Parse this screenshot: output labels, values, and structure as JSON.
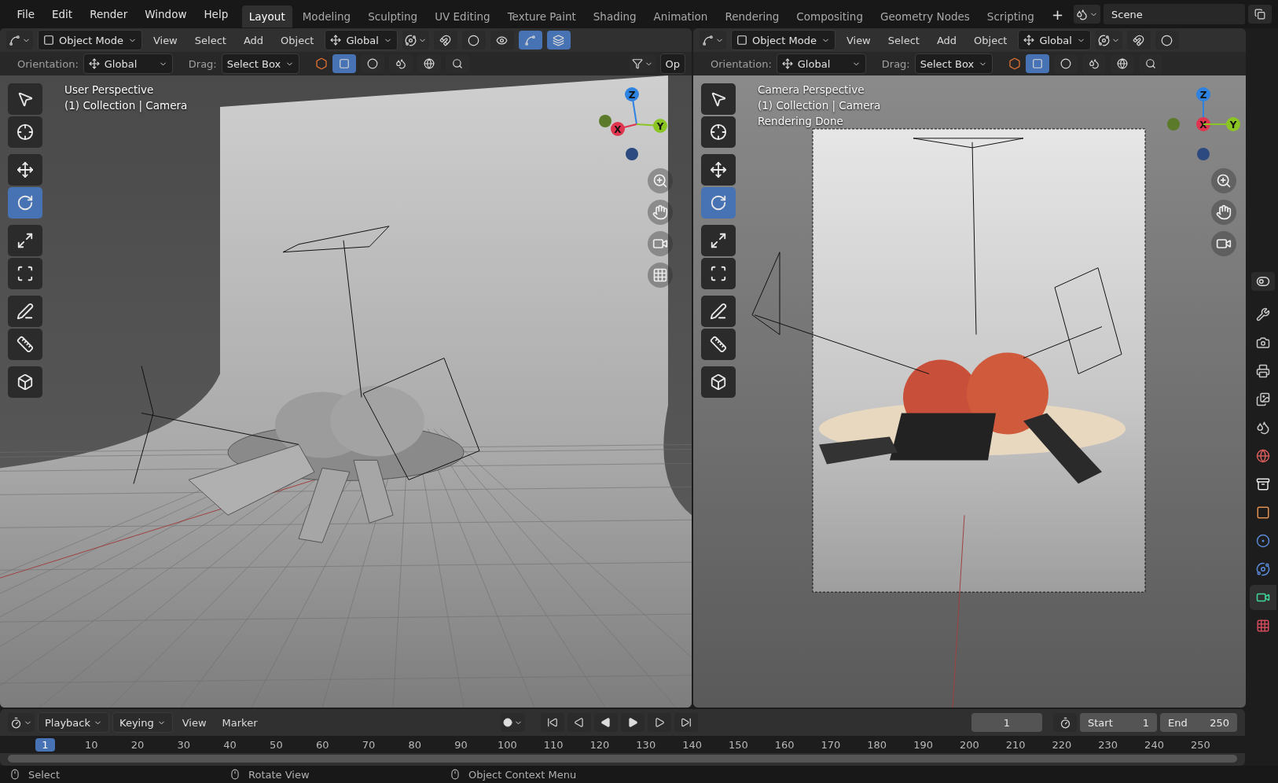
{
  "topbar": {
    "menus": [
      "File",
      "Edit",
      "Render",
      "Window",
      "Help"
    ],
    "workspaces": [
      {
        "label": "Layout",
        "selected": true
      },
      {
        "label": "Modeling",
        "selected": false
      },
      {
        "label": "Sculpting",
        "selected": false
      },
      {
        "label": "UV Editing",
        "selected": false
      },
      {
        "label": "Texture Paint",
        "selected": false
      },
      {
        "label": "Shading",
        "selected": false
      },
      {
        "label": "Animation",
        "selected": false
      },
      {
        "label": "Rendering",
        "selected": false
      },
      {
        "label": "Compositing",
        "selected": false
      },
      {
        "label": "Geometry Nodes",
        "selected": false
      },
      {
        "label": "Scripting",
        "selected": false
      }
    ],
    "add_tab": "+",
    "scene": "Scene"
  },
  "viewports": [
    {
      "kind": "perspective",
      "mode": "Object Mode",
      "menus": [
        "View",
        "Select",
        "Add",
        "Object"
      ],
      "transform": "Global",
      "orientation_label": "Orientation:",
      "orientation": "Global",
      "drag_label": "Drag:",
      "drag": "Select Box",
      "cut_label": "Op",
      "overlay_lines": [
        "User Perspective",
        "(1) Collection | Camera"
      ],
      "toggles": [
        {
          "kind": "snap",
          "on": false
        },
        {
          "kind": "proportional",
          "on": false
        },
        {
          "kind": "visibility",
          "on": false
        },
        {
          "kind": "gizmo",
          "on": true
        },
        {
          "kind": "overlay",
          "on": true
        }
      ],
      "tools": [
        {
          "kind": "select",
          "selected": false
        },
        {
          "kind": "cursor",
          "selected": false
        },
        {
          "kind": "move",
          "selected": false
        },
        {
          "kind": "rotate",
          "selected": true
        },
        {
          "kind": "scale",
          "selected": false
        },
        {
          "kind": "transform",
          "selected": false
        },
        {
          "kind": "annotate",
          "selected": false
        },
        {
          "kind": "measure",
          "selected": false
        },
        {
          "kind": "add-cube",
          "selected": false
        }
      ],
      "axes": [
        {
          "label": "Z",
          "kind": "z"
        },
        {
          "label": "X",
          "kind": "x"
        },
        {
          "label": "Y",
          "kind": "y"
        }
      ],
      "nav": [
        {
          "kind": "zoom"
        },
        {
          "kind": "pan"
        },
        {
          "kind": "camera"
        },
        {
          "kind": "ortho"
        }
      ]
    },
    {
      "kind": "camera",
      "mode": "Object Mode",
      "menus": [
        "View",
        "Select",
        "Add",
        "Object"
      ],
      "transform": "Global",
      "orientation_label": "Orientation:",
      "orientation": "Global",
      "drag_label": "Drag:",
      "drag": "Select Box",
      "overlay_lines": [
        "Camera Perspective",
        "(1) Collection | Camera",
        "Rendering Done"
      ],
      "toggles": [
        {
          "kind": "snap",
          "on": false
        },
        {
          "kind": "proportional",
          "on": false
        }
      ],
      "tools": [
        {
          "kind": "select",
          "selected": false
        },
        {
          "kind": "cursor",
          "selected": false
        },
        {
          "kind": "move",
          "selected": false
        },
        {
          "kind": "rotate",
          "selected": true
        },
        {
          "kind": "scale",
          "selected": false
        },
        {
          "kind": "transform",
          "selected": false
        },
        {
          "kind": "annotate",
          "selected": false
        },
        {
          "kind": "measure",
          "selected": false
        },
        {
          "kind": "add-cube",
          "selected": false
        }
      ],
      "axes": [
        {
          "label": "Z",
          "kind": "z"
        },
        {
          "label": "X",
          "kind": "x"
        },
        {
          "label": "Y",
          "kind": "y"
        }
      ],
      "nav": [
        {
          "kind": "zoom"
        },
        {
          "kind": "pan"
        },
        {
          "kind": "camera"
        }
      ]
    }
  ],
  "properties_tabs": [
    {
      "kind": "tool",
      "selected": false
    },
    {
      "kind": "render",
      "selected": false
    },
    {
      "kind": "output",
      "selected": false
    },
    {
      "kind": "view-layer",
      "selected": false
    },
    {
      "kind": "scene",
      "selected": false
    },
    {
      "kind": "world",
      "selected": false
    },
    {
      "kind": "collection",
      "selected": false
    },
    {
      "kind": "object",
      "selected": false
    },
    {
      "kind": "physics",
      "selected": false
    },
    {
      "kind": "constraint",
      "selected": false
    },
    {
      "kind": "camera-data",
      "selected": true
    },
    {
      "kind": "texture",
      "selected": false
    }
  ],
  "timeline": {
    "menus": [
      {
        "label": "Playback",
        "dropdown": true
      },
      {
        "label": "Keying",
        "dropdown": true
      },
      {
        "label": "View",
        "dropdown": false
      },
      {
        "label": "Marker",
        "dropdown": false
      }
    ],
    "current_frame": "1",
    "start_label": "Start",
    "start": "1",
    "end_label": "End",
    "end": "250",
    "ticks": [
      {
        "label": "1",
        "selected": true
      },
      {
        "label": "10",
        "selected": false
      },
      {
        "label": "20",
        "selected": false
      },
      {
        "label": "30",
        "selected": false
      },
      {
        "label": "40",
        "selected": false
      },
      {
        "label": "50",
        "selected": false
      },
      {
        "label": "60",
        "selected": false
      },
      {
        "label": "70",
        "selected": false
      },
      {
        "label": "80",
        "selected": false
      },
      {
        "label": "90",
        "selected": false
      },
      {
        "label": "100",
        "selected": false
      },
      {
        "label": "110",
        "selected": false
      },
      {
        "label": "120",
        "selected": false
      },
      {
        "label": "130",
        "selected": false
      },
      {
        "label": "140",
        "selected": false
      },
      {
        "label": "150",
        "selected": false
      },
      {
        "label": "160",
        "selected": false
      },
      {
        "label": "170",
        "selected": false
      },
      {
        "label": "180",
        "selected": false
      },
      {
        "label": "190",
        "selected": false
      },
      {
        "label": "200",
        "selected": false
      },
      {
        "label": "210",
        "selected": false
      },
      {
        "label": "220",
        "selected": false
      },
      {
        "label": "230",
        "selected": false
      },
      {
        "label": "240",
        "selected": false
      },
      {
        "label": "250",
        "selected": false
      }
    ]
  },
  "status_bar": [
    {
      "label": "Select"
    },
    {
      "label": "Rotate View"
    },
    {
      "label": "Object Context Menu"
    }
  ]
}
